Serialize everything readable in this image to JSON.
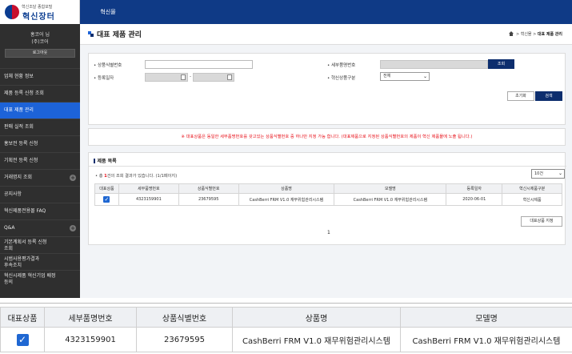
{
  "logo": {
    "small_text": "혁신조달 종합포털",
    "main_text": "혁신장터"
  },
  "top_nav": {
    "item": "혁신몰"
  },
  "user": {
    "name": "홍코어 님",
    "org": "(주)코어",
    "logout": "로그아웃"
  },
  "sidebar": {
    "items": [
      {
        "label": "업체 현황 정보",
        "active": false,
        "expandable": false
      },
      {
        "label": "제품 등록 신청 조회",
        "active": false,
        "expandable": false
      },
      {
        "label": "대표 제품 관리",
        "active": true,
        "expandable": false
      },
      {
        "label": "판매 실적 조회",
        "active": false,
        "expandable": false
      },
      {
        "label": "홍보전 등록 신청",
        "active": false,
        "expandable": false
      },
      {
        "label": "기획전 등록 신청",
        "active": false,
        "expandable": false
      },
      {
        "label": "거래명지 조회",
        "active": false,
        "expandable": true
      },
      {
        "label": "공지사항",
        "active": false,
        "expandable": false
      },
      {
        "label": "혁신제품전용몰 FAQ",
        "active": false,
        "expandable": false
      },
      {
        "label": "Q&A",
        "active": false,
        "expandable": true
      },
      {
        "label": "기본계획서 등록 신청\n조회",
        "active": false,
        "expandable": false
      },
      {
        "label": "시범사용평가결과\n후속조치",
        "active": false,
        "expandable": false
      },
      {
        "label": "혁신시제품 혁신기업 배정\n등의",
        "active": false,
        "expandable": false
      }
    ]
  },
  "page": {
    "title": "대표 제품 관리",
    "breadcrumb": {
      "home_icon": "home-icon",
      "level1": "혁신몰",
      "current": "대표 제품 관리"
    }
  },
  "search": {
    "product_id_label": "• 상품식별번호",
    "product_id_value": "",
    "detail_no_label": "• 세부품명번호",
    "detail_no_value": "",
    "lookup_button": "조회",
    "reg_date_label": "• 등록일자",
    "date_from": "",
    "date_separator": "-",
    "date_to": "",
    "category_label": "• 혁신상품구분",
    "category_value": "전체",
    "reset_button": "초기화",
    "search_button": "검색"
  },
  "notice": "※ 대표상품은 동일한 세부품명번호를 갖고있는 상품식별번호 중 하나만 지정 가능 합니다. (대표제품으로 지정된 상품식별번호의 제품이 혁신 제품몰에 노출 됩니다.)",
  "list": {
    "title": "제품 목록",
    "result_prefix": "• 총 ",
    "result_count": "1",
    "result_suffix": "건의 조회 결과가 있습니다. (1/1페이지)",
    "page_size": "10건",
    "columns": [
      "대표상품",
      "세부품명번호",
      "상품식별번호",
      "상품명",
      "모델명",
      "등록일자",
      "혁신시제품구분"
    ],
    "rows": [
      {
        "representative": true,
        "detail_no": "4323159901",
        "product_id": "23679595",
        "product_name": "CashBerri FRM V1.0 재무위험관리시스템",
        "model_name": "CashBerri FRM V1.0 재무위험관리시스템",
        "reg_date": "2020-06-01",
        "category": "혁신시제품"
      }
    ],
    "designate_button": "대표상품 지정",
    "page": "1"
  },
  "zoom": {
    "columns": [
      "대표상품",
      "세부품명번호",
      "상품식별번호",
      "상품명",
      "모델명"
    ],
    "row": {
      "representative": true,
      "detail_no": "4323159901",
      "product_id": "23679595",
      "product_name": "CashBerri FRM V1.0 재무위험관리시스템",
      "model_name": "CashBerri FRM V1.0 재무위험관리시스템"
    }
  },
  "colors": {
    "header_navy": "#0f3a86",
    "sidebar_bg": "#2f2f2f",
    "active_blue": "#1d63d8",
    "button_navy": "#0d2e6e",
    "notice_red": "#e8111a",
    "checkbox_blue": "#1f67d2"
  }
}
